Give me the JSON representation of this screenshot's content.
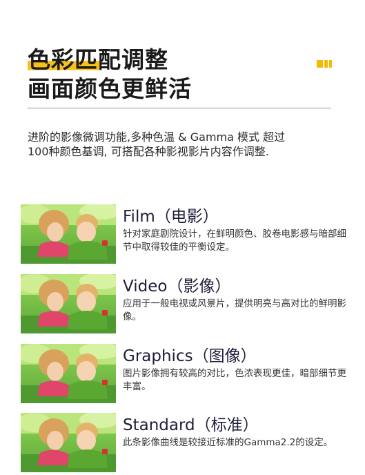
{
  "heading": {
    "line1": "色彩匹配调整",
    "line2": "画面颜色更鲜活"
  },
  "intro": "进阶的影像微调功能,多种色温 & Gamma 模式 超过100种颜色基调, 可搭配各种影视影片内容作调整.",
  "features": [
    {
      "title": "Film（电影）",
      "desc": "针对家庭剧院设计，在鲜明颜色、胶卷电影感与暗部细节中取得较佳的平衡设定。"
    },
    {
      "title": "Video（影像）",
      "desc": "应用于一般电视或风景片，提供明亮与高对比的鲜明影像。"
    },
    {
      "title": "Graphics（图像）",
      "desc": "图片影像拥有较高的对比，色浓表现更佳，暗部细节更丰富。"
    },
    {
      "title": "Standard（标准）",
      "desc": "此条影像曲线是较接近标准的Gamma2.2的设定。"
    }
  ],
  "colors": {
    "accent": "#f6c21a",
    "heading": "#1a1a1a",
    "feature_title": "#1d1d3a"
  },
  "icons": {
    "brand_mark": "yellow-bars-icon",
    "thumbnail": "children-photo"
  }
}
